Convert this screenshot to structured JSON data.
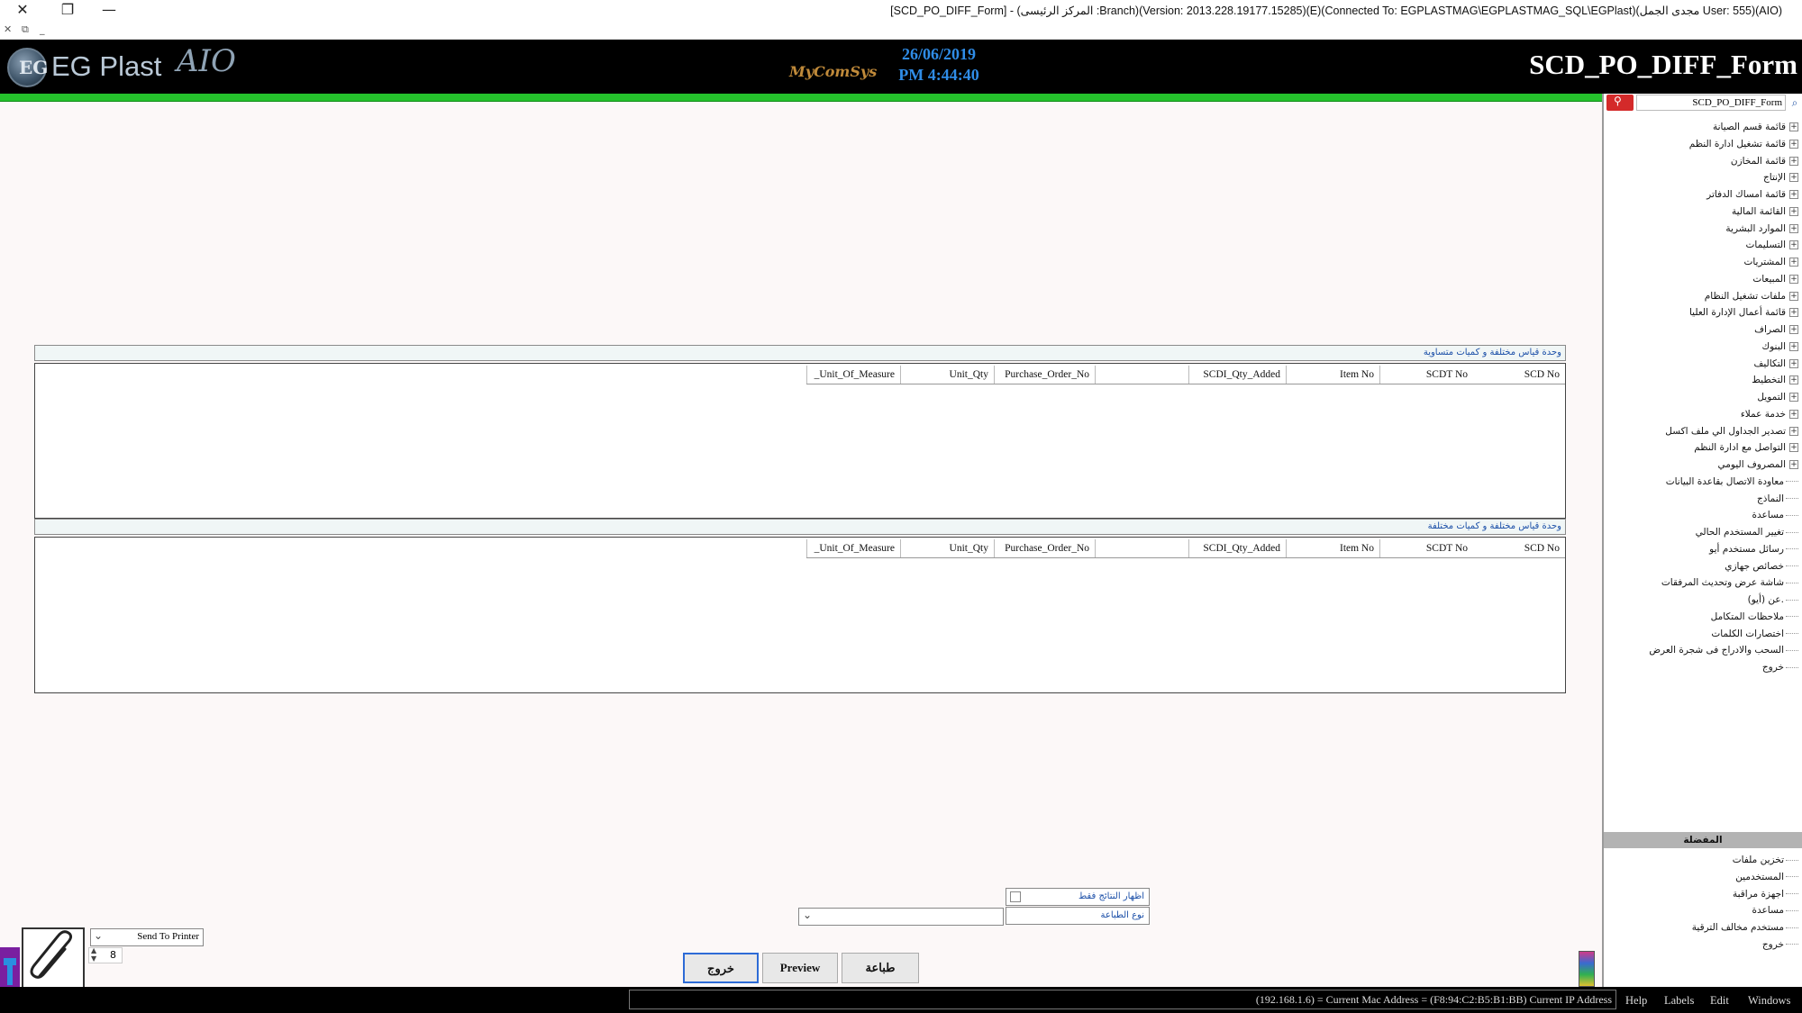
{
  "window": {
    "title": "[SCD_PO_DIFF_Form] - (المركز الرئيسى :Branch)(Version: 2013.228.19177.15285)(E)(Connected To: EGPLASTMAG\\EGPLASTMAG_SQL\\EGPlast)(مجدى الجمل User: 555)(AIO)",
    "close_glyph": "✕",
    "restore_glyph": "❐",
    "minimize_glyph": "—",
    "sub_close": "✕",
    "sub_restore": "⧉",
    "sub_min": "_"
  },
  "header": {
    "logo_text": "EG Plast",
    "logo_sub": "AIO",
    "logo_mark": "EG",
    "brand": "MyComSys",
    "date": "26/06/2019",
    "time": "PM 4:44:40",
    "form_title": "SCD_PO_DIFF_Form",
    "colors": {
      "background": "#000000",
      "date_color": "#2f8ce6",
      "accent_bar": "#25c22c"
    }
  },
  "grids": [
    {
      "caption": "وحدة قياس مختلفة و كميات متساوية",
      "columns": [
        "SCD No",
        "SCDT No",
        "Item No",
        "SCDI_Qty_Added",
        "",
        "Purchase_Order_No",
        "Unit_Qty",
        "_Unit_Of_Measure"
      ]
    },
    {
      "caption": "وحدة قياس مختلفة و كميات مختلفة",
      "columns": [
        "SCD No",
        "SCDT No",
        "Item No",
        "SCDI_Qty_Added",
        "",
        "Purchase_Order_No",
        "Unit_Qty",
        "_Unit_Of_Measure"
      ]
    }
  ],
  "options": {
    "show_results_only": "اظهار النتائج فقط",
    "print_type": "نوع الطباعة",
    "print_type_value": "",
    "send_to_printer": "Send To Printer",
    "copies": "8"
  },
  "buttons": {
    "exit": "خروج",
    "preview": "Preview",
    "print": "طباعة"
  },
  "sidebar": {
    "search_value": "SCD_PO_DIFF_Form",
    "tree": [
      {
        "label": "قائمة قسم الصيانة",
        "expandable": true
      },
      {
        "label": "قائمة تشغيل ادارة النظم",
        "expandable": true
      },
      {
        "label": "قائمة المخازن",
        "expandable": true
      },
      {
        "label": "الإنتاج",
        "expandable": true
      },
      {
        "label": "قائمة امساك الدفاتر",
        "expandable": true
      },
      {
        "label": "القائمة المالية",
        "expandable": true
      },
      {
        "label": "الموارد البشرية",
        "expandable": true
      },
      {
        "label": "التسليمات",
        "expandable": true
      },
      {
        "label": "المشتريات",
        "expandable": true
      },
      {
        "label": "المبيعات",
        "expandable": true
      },
      {
        "label": "ملفات تشغيل النظام",
        "expandable": true
      },
      {
        "label": "قائمة أعمال الإدارة العليا",
        "expandable": true
      },
      {
        "label": "الصراف",
        "expandable": true
      },
      {
        "label": "البنوك",
        "expandable": true
      },
      {
        "label": "التكاليف",
        "expandable": true
      },
      {
        "label": "التخطيط",
        "expandable": true
      },
      {
        "label": "التمويل",
        "expandable": true
      },
      {
        "label": "خدمة عملاء",
        "expandable": true
      },
      {
        "label": "تصدير الجداول الي ملف اكسل",
        "expandable": true
      },
      {
        "label": "التواصل مع ادارة النظم",
        "expandable": true
      },
      {
        "label": "المصروف اليومي",
        "expandable": true
      },
      {
        "label": "معاودة الاتصال بقاعدة البيانات",
        "expandable": false
      },
      {
        "label": "النماذج",
        "expandable": false
      },
      {
        "label": "مساعدة",
        "expandable": false
      },
      {
        "label": "تغيير المستخدم الحالي",
        "expandable": false
      },
      {
        "label": "رسائل مستخدم أيو",
        "expandable": false
      },
      {
        "label": "خصائص جهازي",
        "expandable": false
      },
      {
        "label": "شاشة عرض وتحديث المرفقات",
        "expandable": false
      },
      {
        "label": "عن (أيو).",
        "expandable": false
      },
      {
        "label": "ملاحظات المتكامل",
        "expandable": false
      },
      {
        "label": "اختصارات الكلمات",
        "expandable": false
      },
      {
        "label": "السحب والادراج فى شجرة العرض",
        "expandable": false
      },
      {
        "label": "خروج",
        "expandable": false
      }
    ],
    "favorites_title": "المفضلة",
    "favorites": [
      {
        "label": "تخزين ملفات"
      },
      {
        "label": "المستخدمين"
      },
      {
        "label": "اجهزة مراقبة"
      },
      {
        "label": "مساعدة"
      },
      {
        "label": "مستخدم مخالف الترقية"
      },
      {
        "label": "خروج"
      }
    ]
  },
  "statusbar": {
    "ip_text": "(192.168.1.6) = Current Mac Address = (F8:94:C2:B5:B1:BB) Current IP Address",
    "menus": [
      "Help",
      "Labels",
      "Edit",
      "Windows"
    ]
  }
}
